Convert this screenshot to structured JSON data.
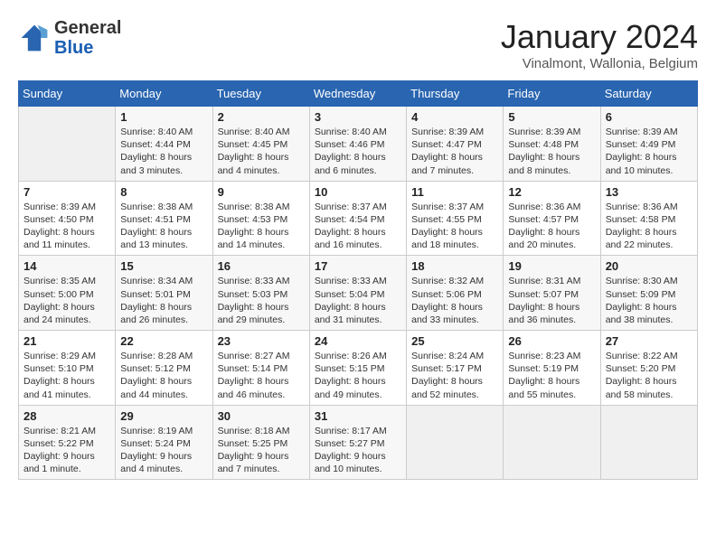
{
  "logo": {
    "general": "General",
    "blue": "Blue"
  },
  "header": {
    "month": "January 2024",
    "location": "Vinalmont, Wallonia, Belgium"
  },
  "weekdays": [
    "Sunday",
    "Monday",
    "Tuesday",
    "Wednesday",
    "Thursday",
    "Friday",
    "Saturday"
  ],
  "weeks": [
    [
      {
        "day": "",
        "sunrise": "",
        "sunset": "",
        "daylight": ""
      },
      {
        "day": "1",
        "sunrise": "Sunrise: 8:40 AM",
        "sunset": "Sunset: 4:44 PM",
        "daylight": "Daylight: 8 hours and 3 minutes."
      },
      {
        "day": "2",
        "sunrise": "Sunrise: 8:40 AM",
        "sunset": "Sunset: 4:45 PM",
        "daylight": "Daylight: 8 hours and 4 minutes."
      },
      {
        "day": "3",
        "sunrise": "Sunrise: 8:40 AM",
        "sunset": "Sunset: 4:46 PM",
        "daylight": "Daylight: 8 hours and 6 minutes."
      },
      {
        "day": "4",
        "sunrise": "Sunrise: 8:39 AM",
        "sunset": "Sunset: 4:47 PM",
        "daylight": "Daylight: 8 hours and 7 minutes."
      },
      {
        "day": "5",
        "sunrise": "Sunrise: 8:39 AM",
        "sunset": "Sunset: 4:48 PM",
        "daylight": "Daylight: 8 hours and 8 minutes."
      },
      {
        "day": "6",
        "sunrise": "Sunrise: 8:39 AM",
        "sunset": "Sunset: 4:49 PM",
        "daylight": "Daylight: 8 hours and 10 minutes."
      }
    ],
    [
      {
        "day": "7",
        "sunrise": "Sunrise: 8:39 AM",
        "sunset": "Sunset: 4:50 PM",
        "daylight": "Daylight: 8 hours and 11 minutes."
      },
      {
        "day": "8",
        "sunrise": "Sunrise: 8:38 AM",
        "sunset": "Sunset: 4:51 PM",
        "daylight": "Daylight: 8 hours and 13 minutes."
      },
      {
        "day": "9",
        "sunrise": "Sunrise: 8:38 AM",
        "sunset": "Sunset: 4:53 PM",
        "daylight": "Daylight: 8 hours and 14 minutes."
      },
      {
        "day": "10",
        "sunrise": "Sunrise: 8:37 AM",
        "sunset": "Sunset: 4:54 PM",
        "daylight": "Daylight: 8 hours and 16 minutes."
      },
      {
        "day": "11",
        "sunrise": "Sunrise: 8:37 AM",
        "sunset": "Sunset: 4:55 PM",
        "daylight": "Daylight: 8 hours and 18 minutes."
      },
      {
        "day": "12",
        "sunrise": "Sunrise: 8:36 AM",
        "sunset": "Sunset: 4:57 PM",
        "daylight": "Daylight: 8 hours and 20 minutes."
      },
      {
        "day": "13",
        "sunrise": "Sunrise: 8:36 AM",
        "sunset": "Sunset: 4:58 PM",
        "daylight": "Daylight: 8 hours and 22 minutes."
      }
    ],
    [
      {
        "day": "14",
        "sunrise": "Sunrise: 8:35 AM",
        "sunset": "Sunset: 5:00 PM",
        "daylight": "Daylight: 8 hours and 24 minutes."
      },
      {
        "day": "15",
        "sunrise": "Sunrise: 8:34 AM",
        "sunset": "Sunset: 5:01 PM",
        "daylight": "Daylight: 8 hours and 26 minutes."
      },
      {
        "day": "16",
        "sunrise": "Sunrise: 8:33 AM",
        "sunset": "Sunset: 5:03 PM",
        "daylight": "Daylight: 8 hours and 29 minutes."
      },
      {
        "day": "17",
        "sunrise": "Sunrise: 8:33 AM",
        "sunset": "Sunset: 5:04 PM",
        "daylight": "Daylight: 8 hours and 31 minutes."
      },
      {
        "day": "18",
        "sunrise": "Sunrise: 8:32 AM",
        "sunset": "Sunset: 5:06 PM",
        "daylight": "Daylight: 8 hours and 33 minutes."
      },
      {
        "day": "19",
        "sunrise": "Sunrise: 8:31 AM",
        "sunset": "Sunset: 5:07 PM",
        "daylight": "Daylight: 8 hours and 36 minutes."
      },
      {
        "day": "20",
        "sunrise": "Sunrise: 8:30 AM",
        "sunset": "Sunset: 5:09 PM",
        "daylight": "Daylight: 8 hours and 38 minutes."
      }
    ],
    [
      {
        "day": "21",
        "sunrise": "Sunrise: 8:29 AM",
        "sunset": "Sunset: 5:10 PM",
        "daylight": "Daylight: 8 hours and 41 minutes."
      },
      {
        "day": "22",
        "sunrise": "Sunrise: 8:28 AM",
        "sunset": "Sunset: 5:12 PM",
        "daylight": "Daylight: 8 hours and 44 minutes."
      },
      {
        "day": "23",
        "sunrise": "Sunrise: 8:27 AM",
        "sunset": "Sunset: 5:14 PM",
        "daylight": "Daylight: 8 hours and 46 minutes."
      },
      {
        "day": "24",
        "sunrise": "Sunrise: 8:26 AM",
        "sunset": "Sunset: 5:15 PM",
        "daylight": "Daylight: 8 hours and 49 minutes."
      },
      {
        "day": "25",
        "sunrise": "Sunrise: 8:24 AM",
        "sunset": "Sunset: 5:17 PM",
        "daylight": "Daylight: 8 hours and 52 minutes."
      },
      {
        "day": "26",
        "sunrise": "Sunrise: 8:23 AM",
        "sunset": "Sunset: 5:19 PM",
        "daylight": "Daylight: 8 hours and 55 minutes."
      },
      {
        "day": "27",
        "sunrise": "Sunrise: 8:22 AM",
        "sunset": "Sunset: 5:20 PM",
        "daylight": "Daylight: 8 hours and 58 minutes."
      }
    ],
    [
      {
        "day": "28",
        "sunrise": "Sunrise: 8:21 AM",
        "sunset": "Sunset: 5:22 PM",
        "daylight": "Daylight: 9 hours and 1 minute."
      },
      {
        "day": "29",
        "sunrise": "Sunrise: 8:19 AM",
        "sunset": "Sunset: 5:24 PM",
        "daylight": "Daylight: 9 hours and 4 minutes."
      },
      {
        "day": "30",
        "sunrise": "Sunrise: 8:18 AM",
        "sunset": "Sunset: 5:25 PM",
        "daylight": "Daylight: 9 hours and 7 minutes."
      },
      {
        "day": "31",
        "sunrise": "Sunrise: 8:17 AM",
        "sunset": "Sunset: 5:27 PM",
        "daylight": "Daylight: 9 hours and 10 minutes."
      },
      {
        "day": "",
        "sunrise": "",
        "sunset": "",
        "daylight": ""
      },
      {
        "day": "",
        "sunrise": "",
        "sunset": "",
        "daylight": ""
      },
      {
        "day": "",
        "sunrise": "",
        "sunset": "",
        "daylight": ""
      }
    ]
  ]
}
